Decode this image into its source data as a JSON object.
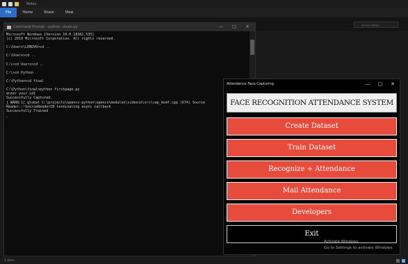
{
  "explorer": {
    "title": "Notes",
    "tabs": [
      "File",
      "Home",
      "Share",
      "View"
    ],
    "search_placeholder": "Search Notes"
  },
  "cmd": {
    "title": "Command Prompt - python .\\main.py",
    "lines": [
      "Microsoft Windows [Version 10.0.18362.535]",
      "(c) 2019 Microsoft Corporation. All rights reserved.",
      "",
      "C:\\Users\\LENOVO>cd ..",
      "",
      "C:\\Users>cd ..",
      "",
      "C:\\>cd Users>cd ..",
      "",
      "C:\\>cd Python",
      "",
      "C:\\Python>cd final",
      "",
      "C:\\Python\\final>python firstpage.py",
      "enter your id1",
      "Successfully Captured.",
      "[ WARN:1] global C:\\projects\\opencv-python\\opencv\\modules\\videoio\\src\\cap_msmf.cpp (674) Source",
      "Reader::~SourceReaderCB terminating async callback",
      "Successfully Trained",
      "_"
    ]
  },
  "app": {
    "title": "Attendance Face Capturing",
    "header": "FACE RECOGNITION ATTENDANCE SYSTEM",
    "buttons": {
      "create": "Create Dataset",
      "train": "Train Dataset",
      "recognize": "Recognize + Attendance",
      "mail": "Mail Attendance",
      "developers": "Developers",
      "exit": "Exit"
    },
    "controls": {
      "minimize": "—",
      "maximize": "□",
      "close": "✕"
    }
  },
  "watermark": {
    "line1": "Activate Windows",
    "line2": "Go to Settings to activate Windows."
  },
  "taskbar": {
    "label": "1 item"
  },
  "colors": {
    "button_bg": "#e74b3c",
    "exit_bg": "#000000",
    "header_bg": "#f0f0f0"
  }
}
